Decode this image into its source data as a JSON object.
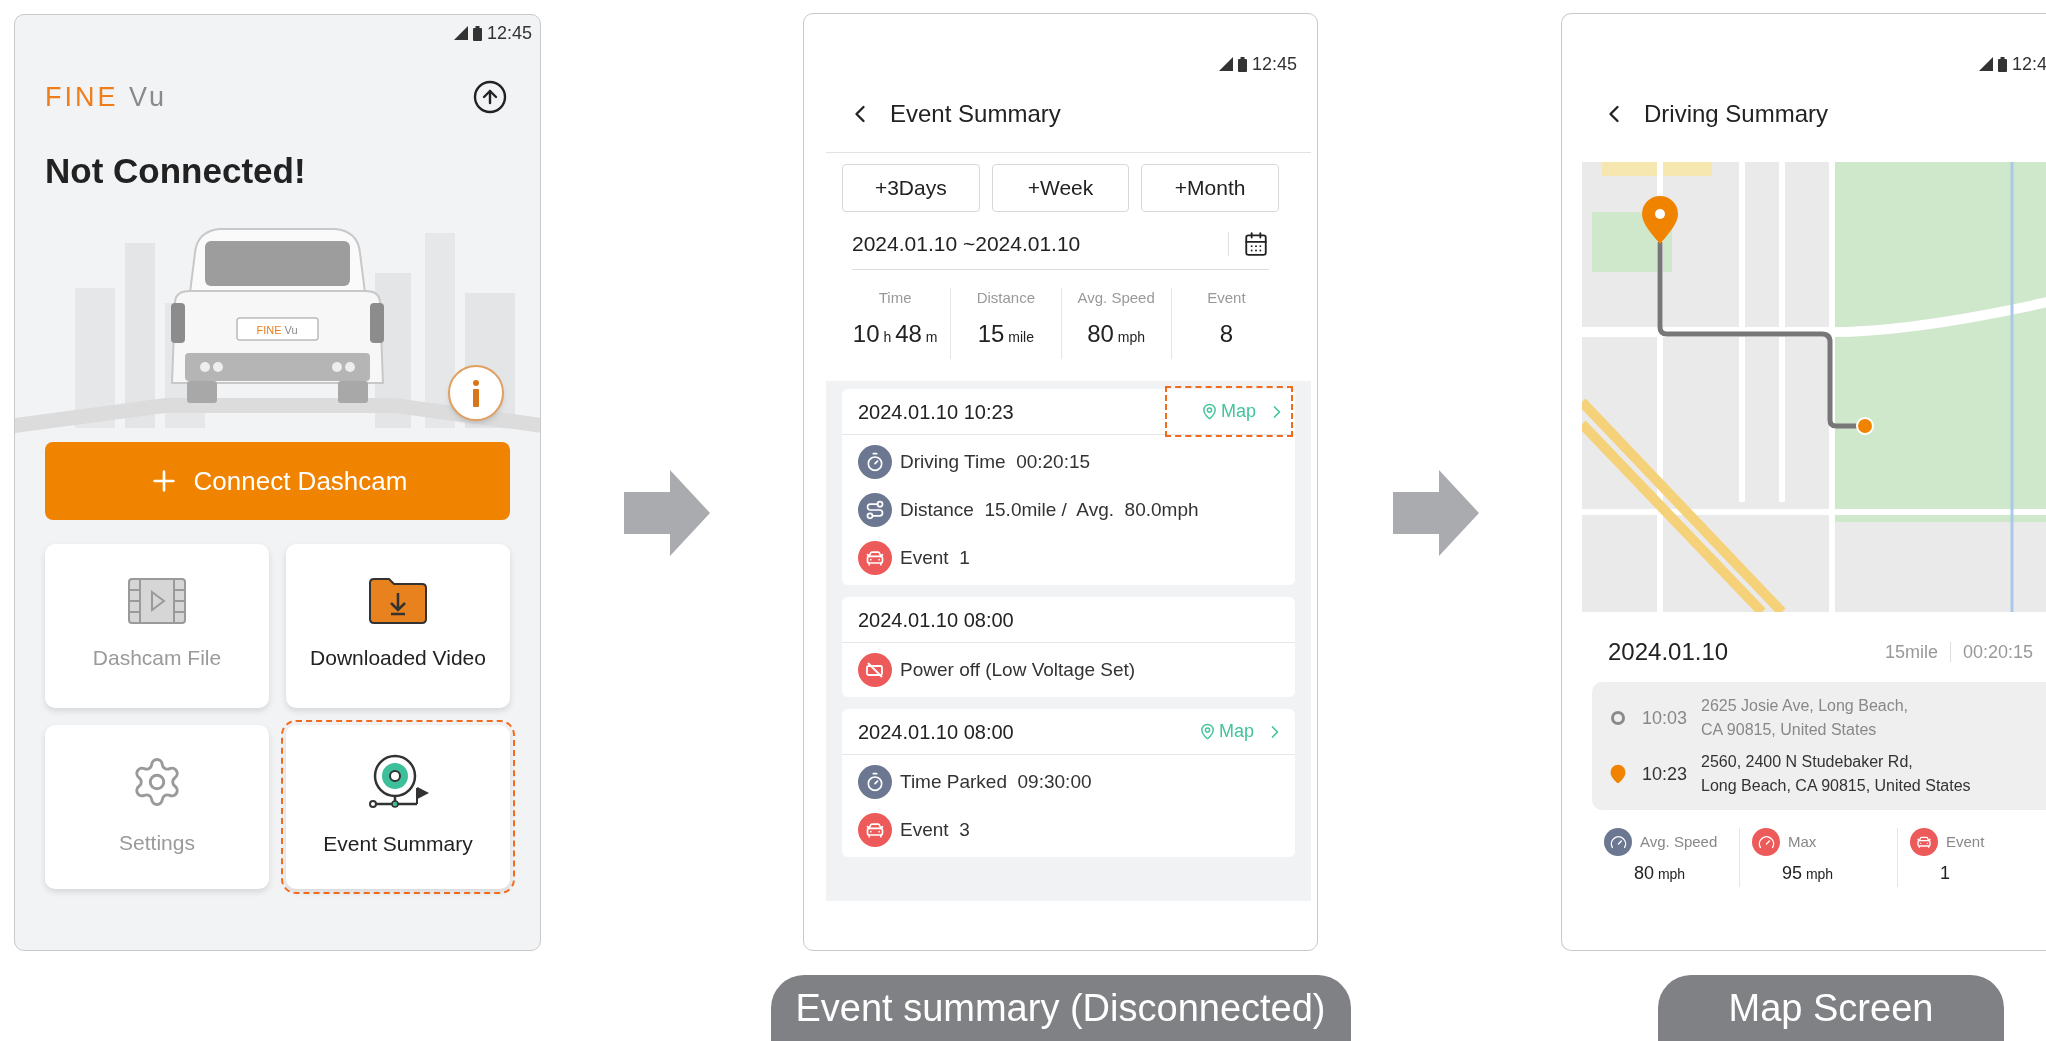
{
  "home_screen": {
    "status_time": "12:45",
    "logo": {
      "brand": "FINE",
      "suffix": "Vu"
    },
    "heading": "Not Connected!",
    "plate": {
      "brand": "FINE",
      "suffix": "Vu"
    },
    "connect_button": "Connect Dashcam",
    "tiles": [
      {
        "kind": "film",
        "label": "Dashcam File",
        "disabled": true,
        "highlighted": false
      },
      {
        "kind": "download",
        "label": "Downloaded Video",
        "disabled": false,
        "highlighted": false
      },
      {
        "kind": "settings",
        "label": "Settings",
        "disabled": true,
        "highlighted": false
      },
      {
        "kind": "event",
        "label": "Event Summary",
        "disabled": false,
        "highlighted": true
      }
    ]
  },
  "event_summary_screen": {
    "status_time": "12:45",
    "title": "Event Summary",
    "range_buttons": [
      "+3Days",
      "+Week",
      "+Month"
    ],
    "date_range": "2024.01.10 ~2024.01.10",
    "stats": [
      {
        "label": "Time",
        "parts": [
          {
            "value": "10",
            "unit": "h"
          },
          {
            "value": "48",
            "unit": "m"
          }
        ]
      },
      {
        "label": "Distance",
        "parts": [
          {
            "value": "15",
            "unit": "mile"
          }
        ]
      },
      {
        "label": "Avg. Speed",
        "parts": [
          {
            "value": "80",
            "unit": "mph"
          }
        ]
      },
      {
        "label": "Event",
        "parts": [
          {
            "value": "8"
          }
        ]
      }
    ],
    "cards": [
      {
        "datetime": "2024.01.10 10:23",
        "map": {
          "label": "Map",
          "highlighted": true
        },
        "items": [
          {
            "kind": "timer",
            "text": "Driving Time  00:20:15"
          },
          {
            "kind": "route",
            "text": "Distance  15.0mile /  Avg.  80.0mph"
          },
          {
            "kind": "event",
            "text": "Event  1"
          }
        ]
      },
      {
        "datetime": "2024.01.10 08:00",
        "items": [
          {
            "kind": "power",
            "text": "Power off (Low Voltage Set)"
          }
        ]
      },
      {
        "datetime": "2024.01.10 08:00",
        "map": {
          "label": "Map",
          "highlighted": false
        },
        "items": [
          {
            "kind": "timer",
            "text": "Time Parked  09:30:00"
          },
          {
            "kind": "event",
            "text": "Event  3"
          }
        ]
      }
    ],
    "caption": "Event summary (Disconnected)"
  },
  "driving_summary_screen": {
    "status_time": "12:4",
    "title": "Driving Summary",
    "date": "2024.01.10",
    "distance": "15mile",
    "duration": "00:20:15",
    "stops": [
      {
        "kind": "start",
        "time": "10:03",
        "address_lines": [
          "2625 Josie Ave, Long Beach,",
          "CA 90815, United States"
        ]
      },
      {
        "kind": "end",
        "time": "10:23",
        "address_lines": [
          "2560, 2400 N Studebaker Rd,",
          "Long Beach, CA 90815, United States"
        ]
      }
    ],
    "stats": [
      {
        "kind": "avg",
        "label": "Avg. Speed",
        "value": "80",
        "unit": "mph"
      },
      {
        "kind": "max",
        "label": "Max",
        "value": "95",
        "unit": "mph"
      },
      {
        "kind": "event",
        "label": "Event",
        "value": "1"
      }
    ],
    "caption": "Map Screen"
  }
}
